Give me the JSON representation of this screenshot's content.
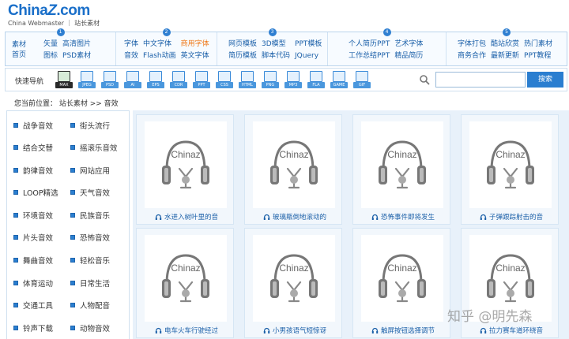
{
  "logo": {
    "main_left": "China",
    "main_z": "Z",
    "main_right": ".com",
    "sub": "China Webmaster ｜ 站长素材"
  },
  "catnav": [
    {
      "num": "1",
      "head": "素材首页",
      "links": [
        {
          "t": "矢量",
          "hot": false
        },
        {
          "t": "高清图片",
          "hot": false
        },
        {
          "t": "",
          "hot": false
        },
        {
          "t": "图标",
          "hot": false
        },
        {
          "t": "PSD素材",
          "hot": false
        },
        {
          "t": "",
          "hot": false
        }
      ]
    },
    {
      "num": "2",
      "head": "",
      "links": [
        {
          "t": "字体",
          "hot": false
        },
        {
          "t": "中文字体",
          "hot": false
        },
        {
          "t": "商用字体",
          "hot": true
        },
        {
          "t": "音效",
          "hot": false
        },
        {
          "t": "Flash动画",
          "hot": false
        },
        {
          "t": "英文字体",
          "hot": false
        }
      ]
    },
    {
      "num": "3",
      "head": "",
      "links": [
        {
          "t": "网页模板",
          "hot": false
        },
        {
          "t": "3D模型",
          "hot": false
        },
        {
          "t": "PPT模板",
          "hot": false
        },
        {
          "t": "简历模板",
          "hot": false
        },
        {
          "t": "脚本代码",
          "hot": false
        },
        {
          "t": "JQuery",
          "hot": false
        }
      ]
    },
    {
      "num": "4",
      "head": "",
      "links": [
        {
          "t": "个人简历PPT",
          "hot": false
        },
        {
          "t": "艺术字体",
          "hot": false
        },
        {
          "t": "",
          "hot": false
        },
        {
          "t": "工作总结PPT",
          "hot": false
        },
        {
          "t": "精品简历",
          "hot": false
        },
        {
          "t": "",
          "hot": false
        }
      ]
    },
    {
      "num": "5",
      "head": "",
      "links": [
        {
          "t": "字体打包",
          "hot": false
        },
        {
          "t": "酷站欣赏",
          "hot": false
        },
        {
          "t": "热门素材",
          "hot": false
        },
        {
          "t": "商务合作",
          "hot": false
        },
        {
          "t": "最新更新",
          "hot": false
        },
        {
          "t": "PPT教程",
          "hot": false
        }
      ]
    }
  ],
  "quick": {
    "label": "快速导航",
    "types": [
      {
        "t": "MAX",
        "dark": true
      },
      {
        "t": "JPEG",
        "dark": false
      },
      {
        "t": "PSD",
        "dark": false
      },
      {
        "t": "AI",
        "dark": false
      },
      {
        "t": "EPS",
        "dark": false
      },
      {
        "t": "CDR",
        "dark": false
      },
      {
        "t": "PPT",
        "dark": false
      },
      {
        "t": "CSS",
        "dark": false
      },
      {
        "t": "HTML",
        "dark": false
      },
      {
        "t": "PNG",
        "dark": false
      },
      {
        "t": "MP3",
        "dark": false
      },
      {
        "t": "FLA",
        "dark": false
      },
      {
        "t": "GAME",
        "dark": false
      },
      {
        "t": "GIF",
        "dark": false
      }
    ],
    "search_value": "",
    "search_button": "搜索"
  },
  "breadcrumb": "您当前位置： 站长素材 >> 音效",
  "sidebar": [
    "战争音效",
    "街头流行",
    "结合交替",
    "摇滚乐音效",
    "韵律音效",
    "网站应用",
    "LOOP精选",
    "天气音效",
    "环境音效",
    "民族音乐",
    "片头音效",
    "恐怖音效",
    "舞曲音效",
    "轻松音乐",
    "体育运动",
    "日常生活",
    "交通工具",
    "人物配音",
    "铃声下载",
    "动物音效"
  ],
  "cards": [
    {
      "brand": "Chinaz",
      "title": "水进入树叶里的音"
    },
    {
      "brand": "Chinaz",
      "title": "玻璃瓶倒地滚动的"
    },
    {
      "brand": "Chinaz",
      "title": "恐怖事件即将发生"
    },
    {
      "brand": "Chinaz",
      "title": "子弹跟踪射击的音"
    },
    {
      "brand": "Chinaz",
      "title": "电车火车行驶经过"
    },
    {
      "brand": "Chinaz",
      "title": "小男孩语气短惊讶"
    },
    {
      "brand": "Chinaz",
      "title": "触屏按钮选择调节"
    },
    {
      "brand": "Chinaz",
      "title": "拉力赛车道环绕音"
    }
  ],
  "watermark": "知乎 @明先森",
  "colors": {
    "brand": "#1a6fc9",
    "link": "#1a5fa8",
    "hot": "#f07a1a",
    "button": "#2a7ed0"
  }
}
